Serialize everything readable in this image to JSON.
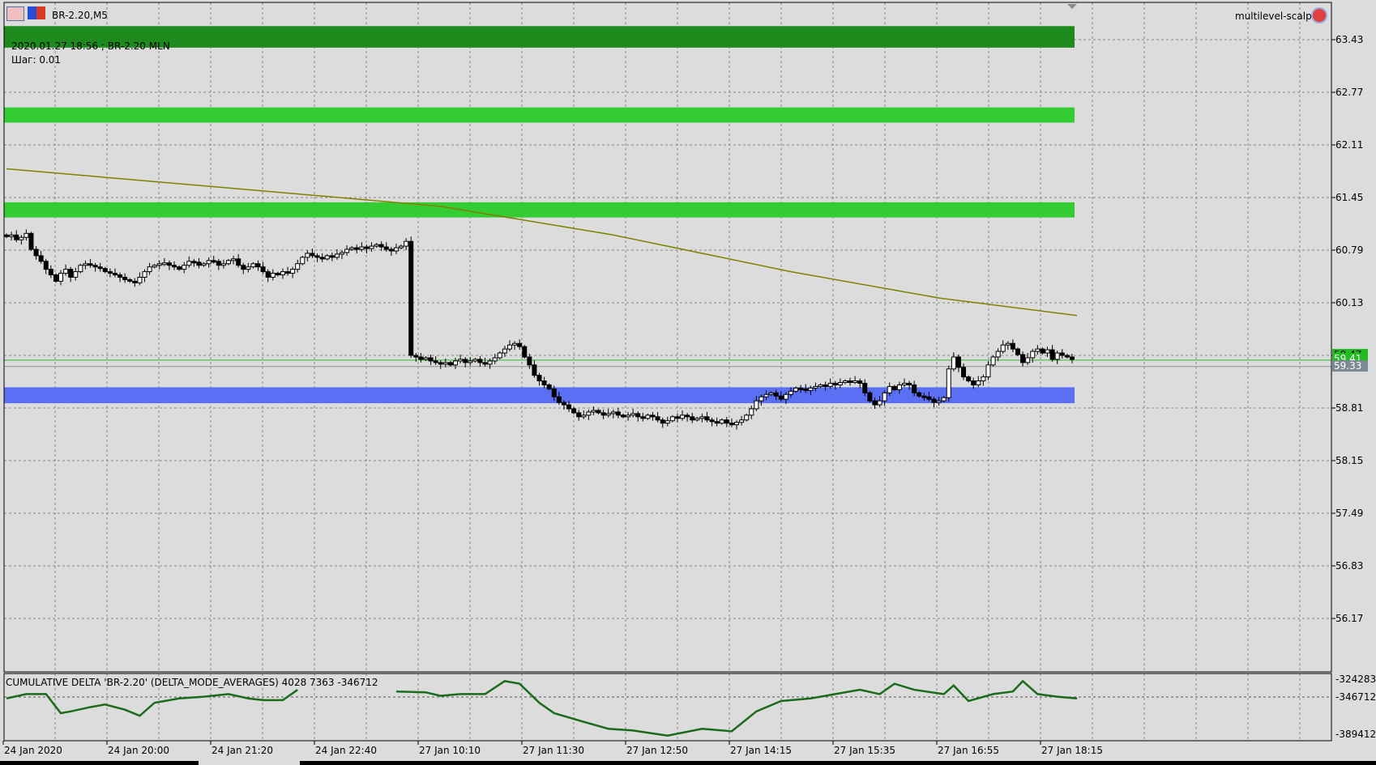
{
  "window": {
    "symbol_title": "BR-2.20,M5",
    "info_line": "2020.01.27 18:56 ; BR-2.20 MLN",
    "step_line": "Шаг: 0.01",
    "expert_name": "multilevel-scalp"
  },
  "colors": {
    "background": "#dcdcdc",
    "level_dark_green": "#1e8a1e",
    "level_green": "#33cc33",
    "level_blue": "#5b6ff5",
    "ma_line": "#808000",
    "indicator_line": "#1a6b1a",
    "bid_line": "#33bb33",
    "ask_line": "#909090"
  },
  "price_axis": {
    "ticks": [
      "63.43",
      "62.77",
      "62.11",
      "61.45",
      "60.79",
      "60.13",
      "59.47",
      "58.81",
      "58.15",
      "57.49",
      "56.83",
      "56.17"
    ],
    "bid_tag": "59.41",
    "ask_tag": "59.33"
  },
  "time_axis": [
    "24 Jan 2020",
    "24 Jan 20:00",
    "24 Jan 21:20",
    "24 Jan 22:40",
    "27 Jan 10:10",
    "27 Jan 11:30",
    "27 Jan 12:50",
    "27 Jan 14:15",
    "27 Jan 15:35",
    "27 Jan 16:55",
    "27 Jan 18:15"
  ],
  "levels": [
    {
      "price_from": 63.33,
      "price_to": 63.6,
      "color": "#1e8a1e"
    },
    {
      "price_from": 62.39,
      "price_to": 62.58,
      "color": "#33cc33"
    },
    {
      "price_from": 61.2,
      "price_to": 61.39,
      "color": "#33cc33"
    },
    {
      "price_from": 58.87,
      "price_to": 59.07,
      "color": "#5b6ff5"
    }
  ],
  "indicator": {
    "title": "CUMULATIVE DELTA 'BR-2.20' (DELTA_MODE_AVERAGES) 4028 7363 -346712",
    "axis": [
      "-324283",
      "-346712",
      "-389412"
    ],
    "points": [
      [
        0,
        -346712
      ],
      [
        4,
        -341662
      ],
      [
        8,
        -341662
      ],
      [
        11,
        -363882
      ],
      [
        13,
        -361862
      ],
      [
        17,
        -356812
      ],
      [
        20,
        -353782
      ],
      [
        24,
        -359842
      ],
      [
        27,
        -366912
      ],
      [
        30,
        -351762
      ],
      [
        35,
        -346712
      ],
      [
        40,
        -344692
      ],
      [
        45,
        -341662
      ],
      [
        49,
        -346712
      ],
      [
        52,
        -348732
      ],
      [
        56,
        -348732
      ],
      [
        59,
        -336612
      ],
      [
        79,
        null
      ],
      [
        79,
        -338632
      ],
      [
        85,
        -339642
      ],
      [
        88,
        -343682
      ],
      [
        92,
        -341662
      ],
      [
        97,
        -341662
      ],
      [
        101,
        -326512
      ],
      [
        104,
        -329542
      ],
      [
        108,
        -351762
      ],
      [
        111,
        -363882
      ],
      [
        117,
        -373982
      ],
      [
        122,
        -382062
      ],
      [
        127,
        -384082
      ],
      [
        134,
        -390142
      ],
      [
        141,
        -382062
      ],
      [
        147,
        -385032
      ],
      [
        152,
        -361862
      ],
      [
        157,
        -349742
      ],
      [
        163,
        -346712
      ],
      [
        168,
        -341662
      ],
      [
        173,
        -336612
      ],
      [
        177,
        -341662
      ],
      [
        180,
        -329542
      ],
      [
        184,
        -336612
      ],
      [
        190,
        -341662
      ],
      [
        192,
        -331562
      ],
      [
        195,
        -349742
      ],
      [
        200,
        -341662
      ],
      [
        204,
        -338632
      ],
      [
        206,
        -326512
      ],
      [
        209,
        -341662
      ],
      [
        213,
        -344692
      ],
      [
        217,
        -346712
      ]
    ]
  },
  "moving_average": [
    [
      0,
      61.81
    ],
    [
      88,
      61.34
    ],
    [
      123,
      60.98
    ],
    [
      159,
      60.52
    ],
    [
      189,
      60.19
    ],
    [
      217,
      59.97
    ]
  ],
  "closes": [
    60.96,
    60.98,
    60.92,
    60.95,
    61.0,
    60.8,
    60.72,
    60.65,
    60.55,
    60.48,
    60.4,
    60.5,
    60.55,
    60.45,
    60.52,
    60.6,
    60.62,
    60.6,
    60.58,
    60.56,
    60.52,
    60.5,
    60.48,
    60.45,
    60.42,
    60.4,
    60.38,
    60.45,
    60.52,
    60.58,
    60.6,
    60.62,
    60.63,
    60.6,
    60.58,
    60.55,
    60.6,
    60.65,
    60.64,
    60.6,
    60.62,
    60.66,
    60.65,
    60.6,
    60.62,
    60.66,
    60.68,
    60.6,
    60.55,
    60.58,
    60.62,
    60.58,
    60.52,
    60.45,
    60.5,
    60.48,
    60.52,
    60.5,
    60.55,
    60.62,
    60.7,
    60.75,
    60.72,
    60.7,
    60.68,
    60.72,
    60.7,
    60.74,
    60.76,
    60.8,
    60.82,
    60.8,
    60.83,
    60.81,
    60.84,
    60.86,
    60.83,
    60.8,
    60.78,
    60.82,
    60.84,
    60.9,
    59.47,
    59.45,
    59.42,
    59.44,
    59.4,
    59.38,
    59.36,
    59.38,
    59.35,
    59.4,
    59.42,
    59.38,
    59.4,
    59.42,
    59.38,
    59.36,
    59.4,
    59.44,
    59.5,
    59.55,
    59.6,
    59.62,
    59.58,
    59.45,
    59.35,
    59.22,
    59.15,
    59.1,
    59.05,
    58.95,
    58.88,
    58.85,
    58.8,
    58.75,
    58.7,
    58.72,
    58.76,
    58.78,
    58.75,
    58.72,
    58.74,
    58.76,
    58.72,
    58.7,
    58.72,
    58.74,
    58.7,
    58.68,
    58.72,
    58.7,
    58.66,
    58.62,
    58.65,
    58.7,
    58.68,
    58.72,
    58.7,
    58.66,
    58.68,
    58.7,
    58.66,
    58.64,
    58.62,
    58.66,
    58.62,
    58.6,
    58.63,
    58.66,
    58.72,
    58.8,
    58.9,
    58.95,
    58.98,
    59.0,
    58.96,
    58.92,
    58.98,
    59.02,
    59.06,
    59.05,
    59.03,
    59.06,
    59.08,
    59.1,
    59.08,
    59.12,
    59.1,
    59.13,
    59.15,
    59.14,
    59.15,
    59.12,
    59.0,
    58.9,
    58.85,
    58.9,
    59.0,
    59.08,
    59.04,
    59.1,
    59.12,
    59.1,
    59.0,
    58.96,
    58.95,
    58.92,
    58.88,
    58.9,
    58.94,
    59.3,
    59.45,
    59.32,
    59.2,
    59.15,
    59.1,
    59.15,
    59.2,
    59.35,
    59.45,
    59.52,
    59.6,
    59.62,
    59.55,
    59.48,
    59.38,
    59.44,
    59.52,
    59.55,
    59.5,
    59.54,
    59.42,
    59.5,
    59.47,
    59.45,
    59.42
  ],
  "bid": 59.41,
  "ask": 59.33
}
